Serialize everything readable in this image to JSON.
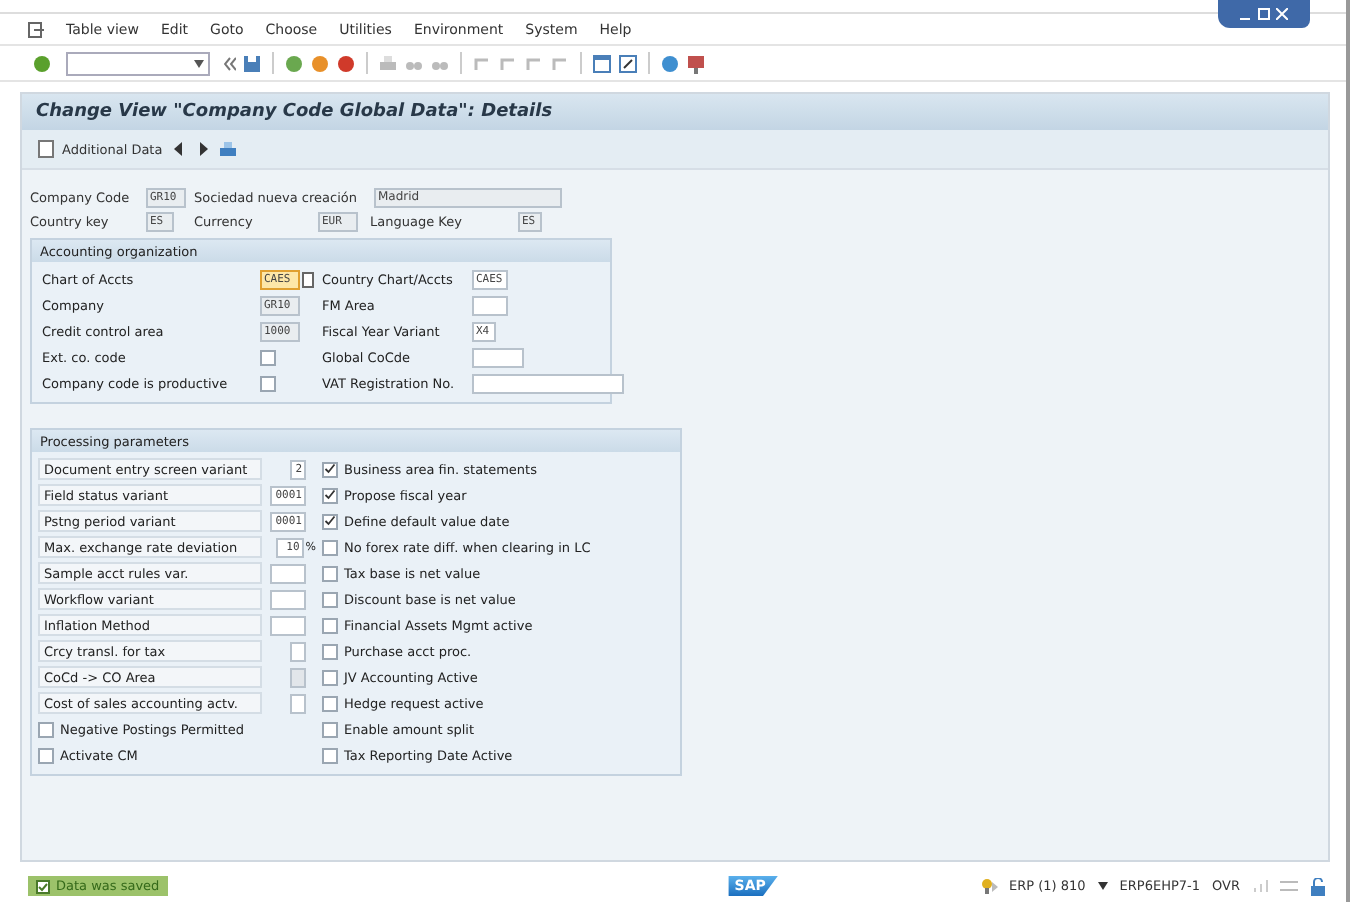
{
  "menu": [
    "Table view",
    "Edit",
    "Goto",
    "Choose",
    "Utilities",
    "Environment",
    "System",
    "Help"
  ],
  "title": "Change View \"Company Code Global Data\": Details",
  "app_toolbar": {
    "button": "Additional Data"
  },
  "header": [
    {
      "label": "Company Code",
      "value": "GR10",
      "text": "Sociedad nueva creación",
      "city": "Madrid"
    },
    {
      "label": "Country key",
      "value": "ES",
      "currency_label": "Currency",
      "currency": "EUR",
      "language_label": "Language Key",
      "language": "ES"
    }
  ],
  "accounting": {
    "title": "Accounting organization",
    "left": [
      {
        "kind": "field",
        "label": "Chart of Accts",
        "value": "CAES",
        "focused": true
      },
      {
        "kind": "field",
        "label": "Company",
        "value": "GR10",
        "focused": false
      },
      {
        "kind": "field",
        "label": "Credit control area",
        "value": "1000",
        "focused": false
      },
      {
        "kind": "checkbox",
        "label": "Ext. co. code",
        "checked": false
      },
      {
        "kind": "checkbox",
        "label": "Company code is productive",
        "checked": false
      }
    ],
    "right": [
      {
        "label": "Country Chart/Accts",
        "value": "CAES"
      },
      {
        "label": "FM Area"
      },
      {
        "label": "Fiscal Year Variant",
        "value": "X4"
      },
      {
        "label": "Global CoCde"
      },
      {
        "label": "VAT Registration No."
      }
    ]
  },
  "processing": {
    "title": "Processing parameters",
    "left": [
      {
        "kind": "field",
        "label": "Document entry screen variant",
        "value": "2",
        "disabled": false
      },
      {
        "kind": "field",
        "label": "Field status variant",
        "value": "0001",
        "disabled": false
      },
      {
        "kind": "field",
        "label": "Pstng period variant",
        "value": "0001",
        "disabled": false
      },
      {
        "kind": "field",
        "label": "Max. exchange rate deviation",
        "value": "10",
        "unit": "%",
        "disabled": false
      },
      {
        "kind": "field",
        "label": "Sample acct rules var.",
        "disabled": false
      },
      {
        "kind": "field",
        "label": "Workflow variant",
        "disabled": false
      },
      {
        "kind": "field",
        "label": "Inflation Method",
        "disabled": false
      },
      {
        "kind": "field",
        "label": "Crcy transl. for tax",
        "disabled": false
      },
      {
        "kind": "field",
        "label": "CoCd -> CO Area",
        "disabled": true
      },
      {
        "kind": "field",
        "label": "Cost of sales accounting actv.",
        "disabled": false
      },
      {
        "kind": "checkbox",
        "label": "Negative Postings Permitted",
        "checked": false
      },
      {
        "kind": "checkbox",
        "label": "Activate CM",
        "checked": false
      }
    ],
    "right": [
      {
        "label": "Business area fin. statements",
        "checked": true
      },
      {
        "label": "Propose fiscal year",
        "checked": true
      },
      {
        "label": "Define default value date",
        "checked": true
      },
      {
        "label": "No forex rate diff. when clearing in LC",
        "checked": false
      },
      {
        "label": "Tax base is net value",
        "checked": false
      },
      {
        "label": "Discount base is net value",
        "checked": false
      },
      {
        "label": "Financial Assets Mgmt active",
        "checked": false
      },
      {
        "label": "Purchase acct proc.",
        "checked": false
      },
      {
        "label": "JV Accounting Active",
        "checked": false
      },
      {
        "label": "Hedge request active",
        "checked": false
      },
      {
        "label": "Enable amount split",
        "checked": false
      },
      {
        "label": "Tax Reporting Date Active",
        "checked": false
      }
    ]
  },
  "status_bar": {
    "message": "Data was saved",
    "success": true,
    "logo": "SAP",
    "system": "ERP (1) 810",
    "server": "ERP6EHP7-1",
    "mode": "OVR"
  }
}
